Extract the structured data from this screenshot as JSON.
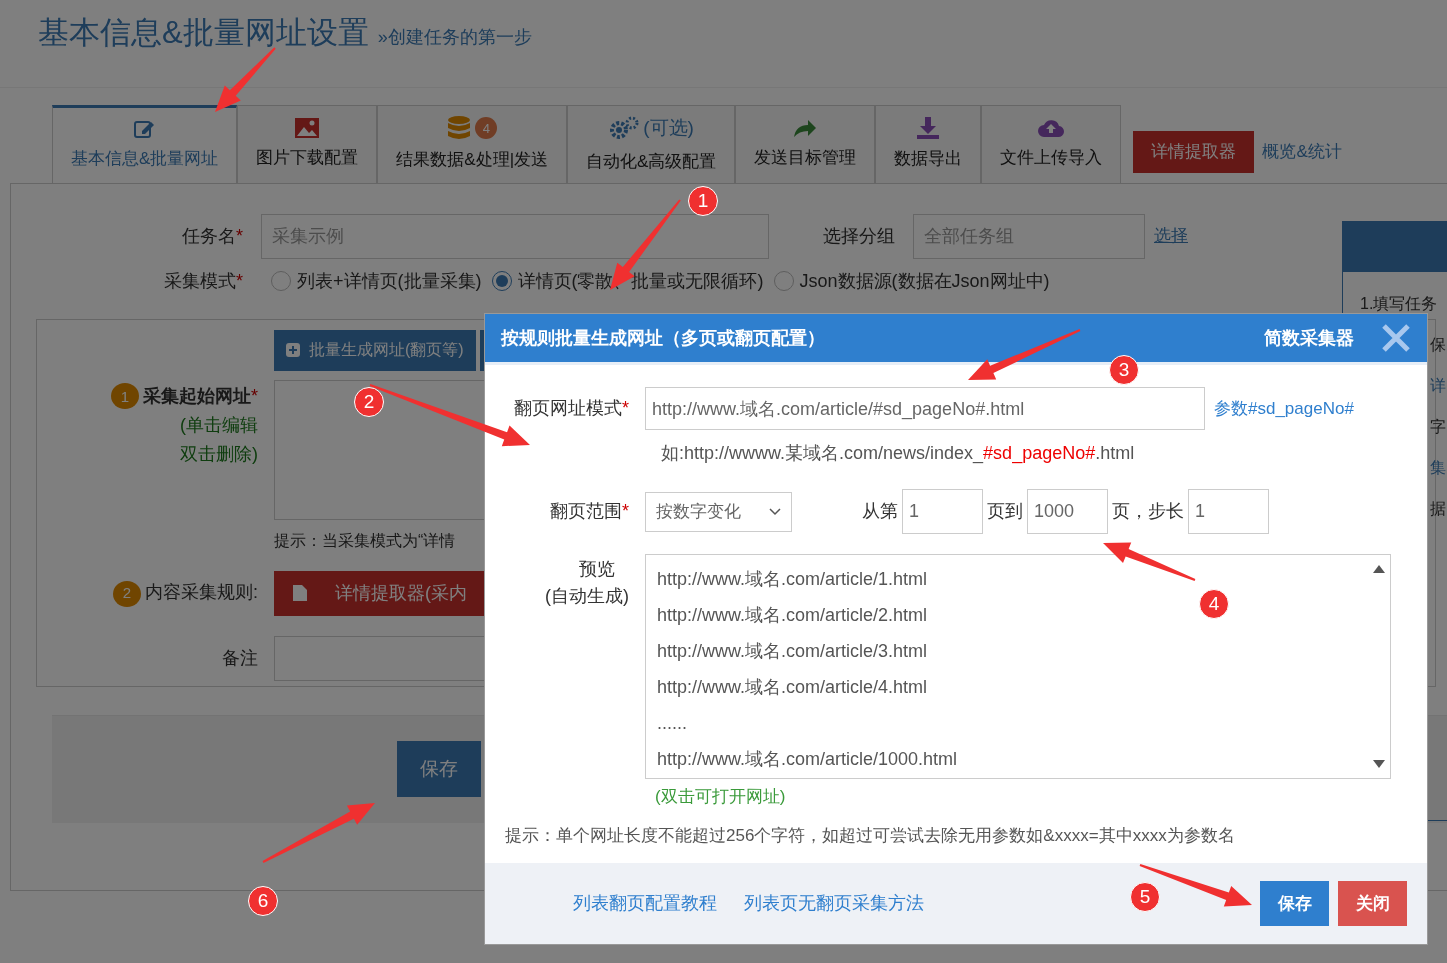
{
  "header": {
    "title": "基本信息&批量网址设置",
    "subtitle": "»创建任务的第一步"
  },
  "tabs": [
    {
      "label": "基本信息&批量网址",
      "selected": true
    },
    {
      "label": "图片下载配置",
      "selected": false
    },
    {
      "label": "结果数据&处理|发送",
      "badge": "4",
      "selected": false
    },
    {
      "label": "自动化&高级配置",
      "note": "(可选)",
      "selected": false
    },
    {
      "label": "发送目标管理",
      "selected": false
    },
    {
      "label": "数据导出",
      "selected": false
    },
    {
      "label": "文件上传导入",
      "selected": false
    }
  ],
  "extractor_button": "详情提取器",
  "overview_link": "概览&统计",
  "form": {
    "task_name_label": "任务名",
    "task_name_mark": "*",
    "task_name_value": "采集示例",
    "group_label": "选择分组",
    "group_value": "全部任务组",
    "group_link": "选择",
    "mode_label": "采集模式",
    "mode_mark": "*",
    "modes": [
      {
        "label": "列表+详情页(批量采集)",
        "selected": false
      },
      {
        "label": "详情页(零散、批量或无限循环)",
        "selected": true
      },
      {
        "label": "Json数据源(数据在Json网址中)",
        "selected": false
      }
    ],
    "start_step": "1",
    "start_label": "采集起始网址",
    "start_mark": "*",
    "start_hint_1": "(单击编辑",
    "start_hint_2": "双击删除)",
    "batch_button": "批量生成网址(翻页等)",
    "start_tip": "提示：当采集模式为“详情",
    "rule_step": "2",
    "rule_label": "内容采集规则:",
    "rule_button": "详情提取器(采内",
    "remark_label": "备注",
    "save_button": "保存"
  },
  "side_panel": {
    "lines": [
      "1.填写任务",
      "保",
      "详",
      "字",
      "集",
      "据"
    ]
  },
  "modal": {
    "title": "按规则批量生成网址（多页或翻页配置）",
    "brand": "简数采集器",
    "pattern_label": "翻页网址模式",
    "pattern_mark": "*",
    "pattern_value": "http://www.域名.com/article/#sd_pageNo#.html",
    "param_link": "参数#sd_pageNo#",
    "example": [
      {
        "text": "如:http://wwww.某域名.com/news/index_",
        "highlight": false
      },
      {
        "text": "#sd_pageNo#",
        "highlight": true
      },
      {
        "text": ".html",
        "highlight": false
      }
    ],
    "range_label": "翻页范围",
    "range_mark": "*",
    "range_select": "按数字变化",
    "from_label": "从第",
    "from_value": "1",
    "to_label": "页到",
    "to_value": "1000",
    "step_label": "页，步长",
    "step_value": "1",
    "preview_label_1": "预览",
    "preview_label_2": "(自动生成)",
    "preview_lines": [
      "http://www.域名.com/article/1.html",
      "http://www.域名.com/article/2.html",
      "http://www.域名.com/article/3.html",
      "http://www.域名.com/article/4.html",
      "......",
      "http://www.域名.com/article/1000.html"
    ],
    "preview_hint": "(双击可打开网址)",
    "tip": "提示：单个网址长度不能超过256个字符，如超过可尝试去除无用参数如&xxxx=其中xxxx为参数名",
    "footer_links": [
      "列表翻页配置教程",
      "列表页无翻页采集方法"
    ],
    "save_button": "保存",
    "close_button": "关闭"
  },
  "annotations": [
    {
      "number": "1"
    },
    {
      "number": "2"
    },
    {
      "number": "3"
    },
    {
      "number": "4"
    },
    {
      "number": "5"
    },
    {
      "number": "6"
    }
  ]
}
